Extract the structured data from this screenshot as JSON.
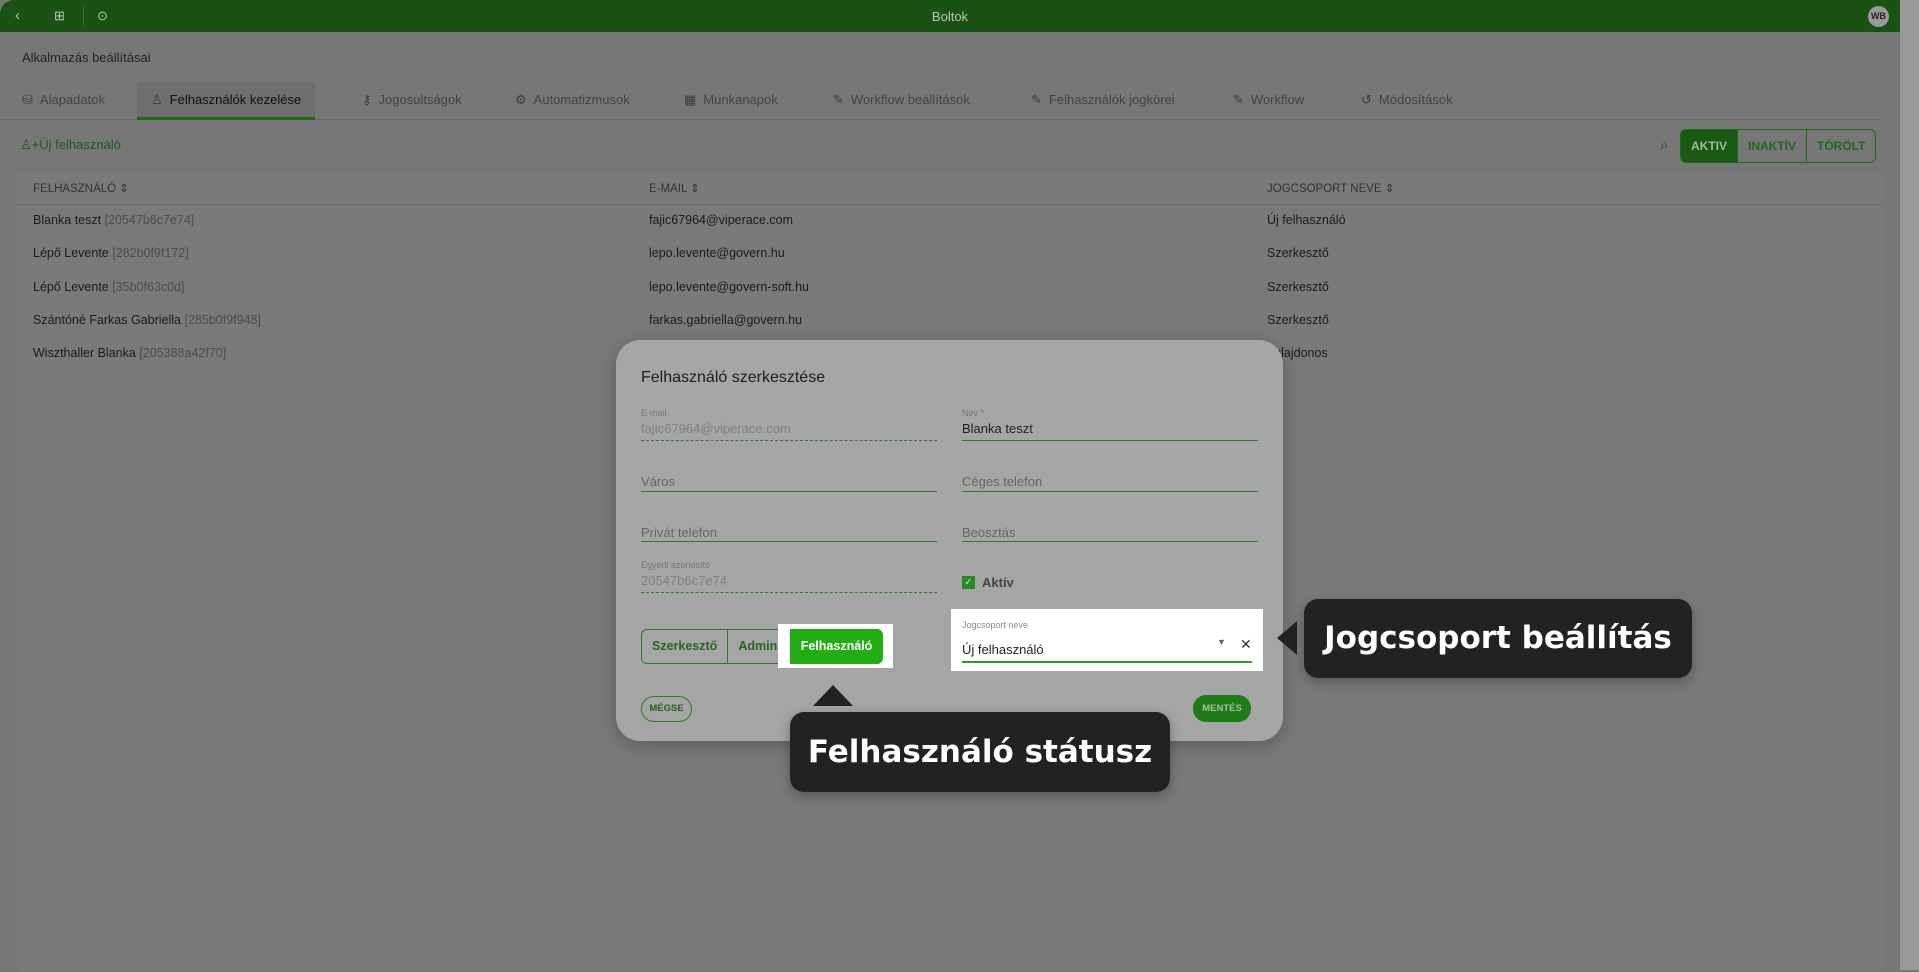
{
  "topbar": {
    "title": "Boltok",
    "avatar": "WB",
    "icons": [
      "chevron-left-icon",
      "apps-icon",
      "play-circle-icon"
    ]
  },
  "page": {
    "title": "Alkalmazás beállításai"
  },
  "tabs": [
    {
      "label": "Alapadatok",
      "icon": "database-icon"
    },
    {
      "label": "Felhasználók kezelése",
      "icon": "user-icon",
      "active": true
    },
    {
      "label": "Jogosultságok",
      "icon": "key-icon"
    },
    {
      "label": "Automatizmusok",
      "icon": "sync-gear-icon"
    },
    {
      "label": "Munkanapok",
      "icon": "calendar-icon"
    },
    {
      "label": "Workflow beállítások",
      "icon": "pencil-icon"
    },
    {
      "label": "Felhasználók jogkörei",
      "icon": "pencil-icon"
    },
    {
      "label": "Workflow",
      "icon": "pencil-icon"
    },
    {
      "label": "Módosítások",
      "icon": "history-icon"
    }
  ],
  "toolbar": {
    "new_user": "Új felhasználó",
    "filters": [
      "AKTIV",
      "INAKTÍV",
      "TÖRÖLT"
    ],
    "active_filter": "AKTIV"
  },
  "table": {
    "headers": [
      "FELHASZNÁLÓ",
      "E-MAIL",
      "JOGCSOPORT NEVE"
    ],
    "rows": [
      {
        "name": "Blanka teszt",
        "id": "[20547b6c7e74]",
        "email": "fajic67964@viperace.com",
        "group": "Új felhasználó"
      },
      {
        "name": "Lépő Levente",
        "id": "[282b0f9f172]",
        "email": "lepo.levente@govern.hu",
        "group": "Szerkesztő"
      },
      {
        "name": "Lépő Levente",
        "id": "[35b0f63c0d]",
        "email": "lepo.levente@govern-soft.hu",
        "group": "Szerkesztő"
      },
      {
        "name": "Szántóné Farkas Gabriella",
        "id": "[285b0f9f948]",
        "email": "farkas.gabriella@govern.hu",
        "group": "Szerkesztő"
      },
      {
        "name": "Wiszthaller Blanka",
        "id": "[205388a42f70]",
        "email": "",
        "group": "Tulajdonos"
      }
    ]
  },
  "dialog": {
    "title": "Felhasználó szerkesztése",
    "email": {
      "label": "E-mail",
      "value": "fajic67964@viperace.com"
    },
    "name": {
      "label": "Név *",
      "value": "Blanka teszt"
    },
    "city": {
      "placeholder": "Város"
    },
    "company_phone": {
      "placeholder": "Céges telefon"
    },
    "private_phone": {
      "placeholder": "Privát telefon"
    },
    "position": {
      "placeholder": "Beosztás"
    },
    "uid": {
      "label": "Egyedi azonosító",
      "value": "20547b6c7e74"
    },
    "active": {
      "label": "Aktív",
      "checked": true
    },
    "status_buttons": [
      "Szerkesztő",
      "Admin",
      "Felhasználó"
    ],
    "selected_status": "Felhasználó",
    "group": {
      "label": "Jogcsoport neve",
      "value": "Új felhasználó"
    },
    "cancel": "MÉGSE",
    "save": "MENTÉS"
  },
  "callouts": {
    "status": "Felhasználó státusz",
    "group": "Jogcsoport beállítás"
  }
}
